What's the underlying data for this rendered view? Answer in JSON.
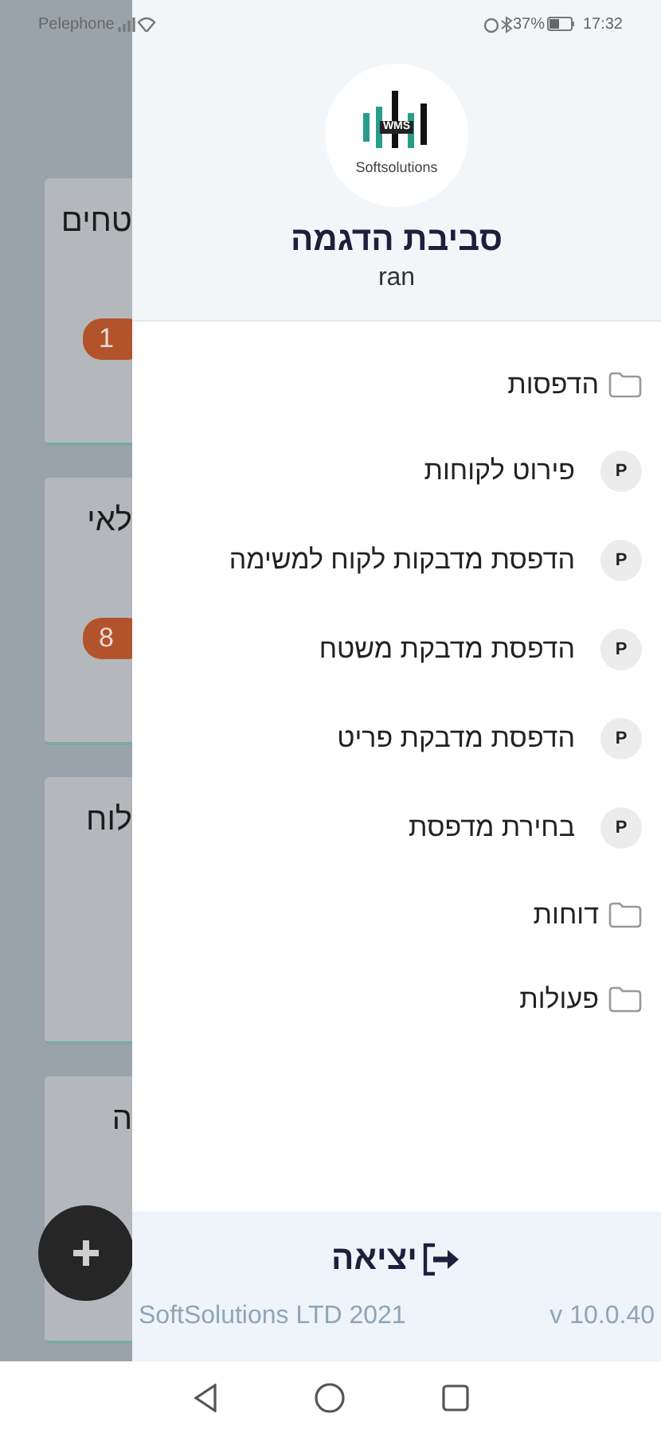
{
  "status_bar": {
    "carrier": "Pelephone",
    "battery": "37%",
    "time": "17:32"
  },
  "background": {
    "cards": [
      {
        "title": "טחים",
        "badge": "1"
      },
      {
        "title": "לאי",
        "badge": "8"
      },
      {
        "title": "לוח"
      },
      {
        "title": "ה"
      }
    ]
  },
  "drawer": {
    "logo": {
      "mark": "WMS",
      "caption": "Softsolutions"
    },
    "title": "סביבת הדגמה",
    "user": "ran",
    "menu": [
      {
        "kind": "folder",
        "label": "הדפסות",
        "children": [
          {
            "kind": "action",
            "badge": "P",
            "label": "פירוט לקוחות"
          },
          {
            "kind": "action",
            "badge": "P",
            "label": "הדפסת מדבקות לקוח למשימה"
          },
          {
            "kind": "action",
            "badge": "P",
            "label": "הדפסת מדבקת משטח"
          },
          {
            "kind": "action",
            "badge": "P",
            "label": "הדפסת מדבקת פריט"
          },
          {
            "kind": "action",
            "badge": "P",
            "label": "בחירת מדפסת"
          }
        ]
      },
      {
        "kind": "folder",
        "label": "דוחות"
      },
      {
        "kind": "folder",
        "label": "פעולות"
      }
    ],
    "exit": "יציאה",
    "company": "SoftSolutions LTD 2021",
    "version": "v 10.0.40"
  }
}
